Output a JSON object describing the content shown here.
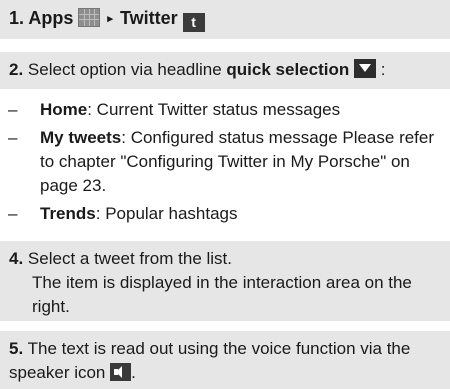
{
  "step1": {
    "number": "1.",
    "apps_label": "Apps",
    "arrow": "▸",
    "twitter_label": "Twitter",
    "icons": [
      "apps-grid-icon",
      "twitter-bird-icon"
    ]
  },
  "step2": {
    "number": "2.",
    "text": "Select option via headline",
    "bold": "quick selection",
    "suffix": ":",
    "icon": "dropdown-arrow-icon"
  },
  "options": [
    {
      "term": "Home",
      "desc": ": Current Twitter status messages"
    },
    {
      "term": "My tweets",
      "desc": ": Configured status message Please refer to chapter \"Configuring Twitter in My Porsche\" on page 23."
    },
    {
      "term": "Trends",
      "desc": ": Popular hashtags"
    }
  ],
  "step4": {
    "number": "4.",
    "line1": "Select a tweet from the list.",
    "line2": "The item is displayed in the interaction area on the right."
  },
  "step5": {
    "number": "5.",
    "text": "The text is read out using the voice function via the speaker icon",
    "suffix": ".",
    "icon": "speaker-icon"
  },
  "bullet_dash": "–",
  "twitter_glyph": "t"
}
